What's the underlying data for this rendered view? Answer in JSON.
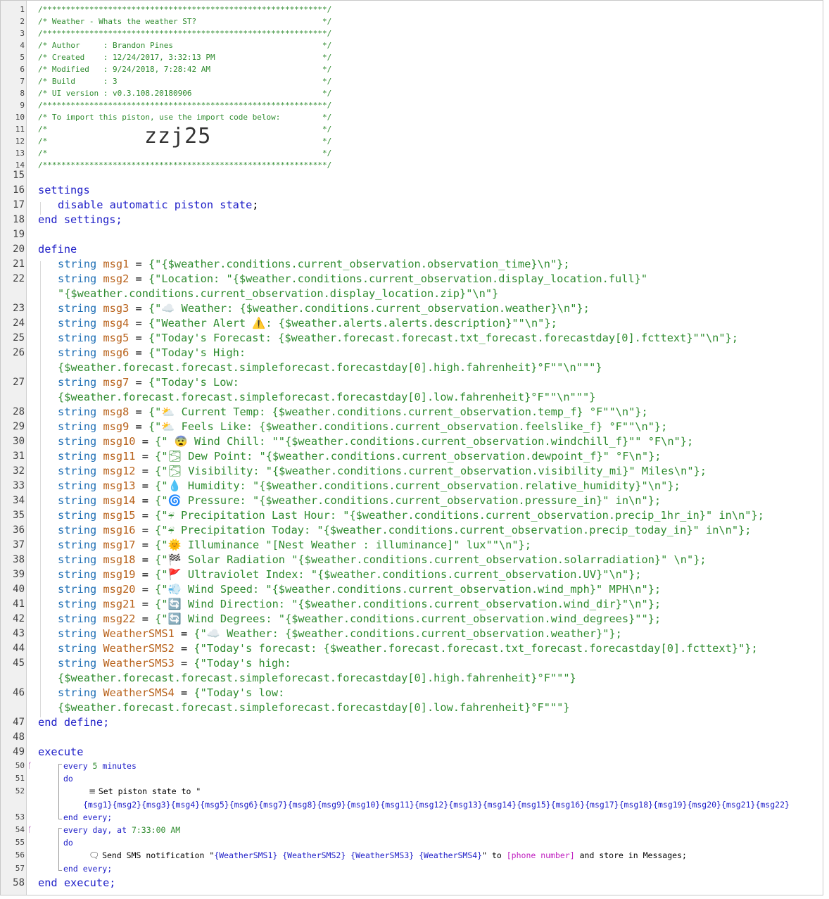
{
  "header": {
    "lines": [
      "/*************************************************************/",
      "/* Weather - Whats the weather ST?                           */",
      "/*************************************************************/",
      "/* Author     : Brandon Pines                                */",
      "/* Created    : 12/24/2017, 3:32:13 PM                       */",
      "/* Modified   : 9/24/2018, 7:28:42 AM                        */",
      "/* Build      : 3                                            */",
      "/* UI version : v0.3.108.20180906                            */",
      "/*************************************************************/",
      "/* To import this piston, use the import code below:         */",
      "/*                                                           */",
      "/*                                                           */",
      "/*                                                           */",
      "/*************************************************************/"
    ],
    "import_code": "zzj25"
  },
  "line_numbers": [
    "1",
    "2",
    "3",
    "4",
    "5",
    "6",
    "7",
    "8",
    "9",
    "10",
    "11",
    "12",
    "13",
    "14",
    "15",
    "16",
    "17",
    "18",
    "19",
    "20",
    "21",
    "22",
    "23",
    "24",
    "25",
    "26",
    "27",
    "28",
    "29",
    "30",
    "31",
    "32",
    "33",
    "34",
    "35",
    "36",
    "37",
    "38",
    "39",
    "40",
    "41",
    "42",
    "43",
    "44",
    "45",
    "46",
    "47",
    "48",
    "49",
    "50",
    "51",
    "52",
    "53",
    "54",
    "55",
    "56",
    "57",
    "58"
  ],
  "settings": {
    "open": "settings",
    "body": "disable automatic piston state",
    "semicolon": ";",
    "close": "end settings;"
  },
  "define": {
    "open": "define",
    "close": "end define;",
    "type": "string",
    "vars": [
      {
        "name": "msg1",
        "value": "{\"{$weather.conditions.current_observation.observation_time}\\n\"};"
      },
      {
        "name": "msg2",
        "value": "{\"Location: \"{$weather.conditions.current_observation.display_location.full}\"",
        "value2": "\"{$weather.conditions.current_observation.display_location.zip}\"\\n\"}"
      },
      {
        "name": "msg3",
        "value": "{\"☁️ Weather: {$weather.conditions.current_observation.weather}\\n\"};"
      },
      {
        "name": "msg4",
        "value": "{\"Weather Alert ⚠️: {$weather.alerts.alerts.description}\"\"\\n\"};"
      },
      {
        "name": "msg5",
        "value": "{\"Today's Forecast: {$weather.forecast.forecast.txt_forecast.forecastday[0].fcttext}\"\"\\n\"};"
      },
      {
        "name": "msg6",
        "value": "{\"Today's High:",
        "value2": "{$weather.forecast.forecast.simpleforecast.forecastday[0].high.fahrenheit}°F\"\"\\n\"\"\"}"
      },
      {
        "name": "msg7",
        "value": "{\"Today's Low:",
        "value2": "{$weather.forecast.forecast.simpleforecast.forecastday[0].low.fahrenheit}°F\"\"\\n\"\"\"}"
      },
      {
        "name": "msg8",
        "value": "{\"⛅ Current Temp: {$weather.conditions.current_observation.temp_f} °F\"\"\\n\"};"
      },
      {
        "name": "msg9",
        "value": "{\"⛅ Feels Like: {$weather.conditions.current_observation.feelslike_f} °F\"\"\\n\"};"
      },
      {
        "name": "msg10",
        "value": "{\" 😨 Wind Chill: \"\"{$weather.conditions.current_observation.windchill_f}\"\" °F\\n\"};"
      },
      {
        "name": "msg11",
        "value": "{\"🌫 Dew Point: \"{$weather.conditions.current_observation.dewpoint_f}\" °F\\n\"};"
      },
      {
        "name": "msg12",
        "value": "{\"🌫 Visibility: \"{$weather.conditions.current_observation.visibility_mi}\" Miles\\n\"};"
      },
      {
        "name": "msg13",
        "value": "{\"💧 Humidity: \"{$weather.conditions.current_observation.relative_humidity}\"\\n\"};"
      },
      {
        "name": "msg14",
        "value": "{\"🌀 Pressure: \"{$weather.conditions.current_observation.pressure_in}\" in\\n\"};"
      },
      {
        "name": "msg15",
        "value": "{\"☔ Precipitation Last Hour: \"{$weather.conditions.current_observation.precip_1hr_in}\" in\\n\"};"
      },
      {
        "name": "msg16",
        "value": "{\"☔ Precipitation Today: \"{$weather.conditions.current_observation.precip_today_in}\" in\\n\"};"
      },
      {
        "name": "msg17",
        "value": "{\"🌞 Illuminance \"[Nest Weather : illuminance]\" lux\"\"\\n\"};"
      },
      {
        "name": "msg18",
        "value": "{\"🏁 Solar Radiation \"{$weather.conditions.current_observation.solarradiation}\" \\n\"};"
      },
      {
        "name": "msg19",
        "value": "{\"🚩 Ultraviolet Index: \"{$weather.conditions.current_observation.UV}\"\\n\"};"
      },
      {
        "name": "msg20",
        "value": "{\"💨 Wind Speed: \"{$weather.conditions.current_observation.wind_mph}\" MPH\\n\"};"
      },
      {
        "name": "msg21",
        "value": "{\"🔄 Wind Direction: \"{$weather.conditions.current_observation.wind_dir}\"\\n\"};"
      },
      {
        "name": "msg22",
        "value": "{\"🔄 Wind Degrees: \"{$weather.conditions.current_observation.wind_degrees}\"\"};"
      },
      {
        "name": "WeatherSMS1",
        "value": "{\"☁️ Weather: {$weather.conditions.current_observation.weather}\"};"
      },
      {
        "name": "WeatherSMS2",
        "value": "{\"Today's forecast: {$weather.forecast.forecast.txt_forecast.forecastday[0].fcttext}\"};"
      },
      {
        "name": "WeatherSMS3",
        "value": "{\"Today's high:",
        "value2": "{$weather.forecast.forecast.simpleforecast.forecastday[0].high.fahrenheit}°F\"\"\"}"
      },
      {
        "name": "WeatherSMS4",
        "value": "{\"Today's low:",
        "value2": "{$weather.forecast.forecast.simpleforecast.forecastday[0].low.fahrenheit}°F\"\"\"}"
      }
    ]
  },
  "execute": {
    "open": "execute",
    "close": "end execute;",
    "block1": {
      "every": "every",
      "interval": "5",
      "unit": "minutes",
      "do": "do",
      "action_text": "Set piston state to \"",
      "action_value": "{msg1}{msg2}{msg3}{msg4}{msg5}{msg6}{msg7}{msg8}{msg9}{msg10}{msg11}{msg12}{msg13}{msg14}{msg15}{msg16}{msg17}{msg18}{msg19}{msg20}{msg21}{msg22}",
      "end": "end every;"
    },
    "block2": {
      "every": "every",
      "unit": "day,",
      "at": "at",
      "time": "7:33:00 AM",
      "do": "do",
      "action_prefix": "Send SMS notification \"",
      "action_value": "{WeatherSMS1} {WeatherSMS2} {WeatherSMS3} {WeatherSMS4}",
      "action_mid": "\" to",
      "phone": "[phone number]",
      "action_suffix": "and store in Messages;",
      "end": "end every;"
    }
  },
  "colors": {
    "keyword": "#2020c8",
    "type": "#1f6fb5",
    "variable": "#b8621b",
    "string": "#2e8b2e",
    "magenta": "#c020c0"
  }
}
